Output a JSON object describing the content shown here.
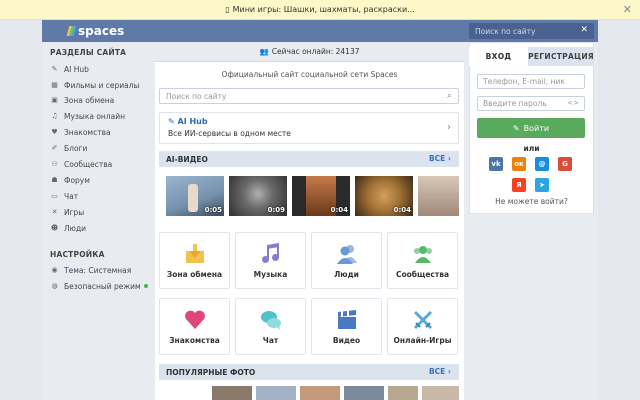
{
  "banner": {
    "text": "Мини игры: Шашки, шахматы, раскраски..."
  },
  "header": {
    "logo": "spaces",
    "search_placeholder": "Поиск по сайту"
  },
  "sidebar": {
    "sections_title": "РАЗДЕЛЫ САЙТА",
    "items": [
      {
        "label": "AI Hub",
        "icon": "wand-icon"
      },
      {
        "label": "Фильмы и сериалы",
        "icon": "film-icon"
      },
      {
        "label": "Зона обмена",
        "icon": "download-icon"
      },
      {
        "label": "Музыка онлайн",
        "icon": "music-icon"
      },
      {
        "label": "Знакомства",
        "icon": "heart-icon"
      },
      {
        "label": "Блоги",
        "icon": "pencil-icon"
      },
      {
        "label": "Сообщества",
        "icon": "community-icon"
      },
      {
        "label": "Форум",
        "icon": "forum-icon"
      },
      {
        "label": "Чат",
        "icon": "chat-icon"
      },
      {
        "label": "Игры",
        "icon": "games-icon"
      },
      {
        "label": "Люди",
        "icon": "people-icon"
      }
    ],
    "settings_title": "НАСТРОЙКА",
    "settings": [
      {
        "label": "Тема: Системная",
        "icon": "palette-icon"
      },
      {
        "label": "Безопасный режим",
        "icon": "safe-mode-icon"
      }
    ]
  },
  "main": {
    "online": "Сейчас онлайн: 24137",
    "official": "Официальный сайт социальной сети Spaces",
    "search_placeholder": "Поиск по сайту",
    "aihub_title": "AI Hub",
    "aihub_sub": "Все ИИ-сервисы в одном месте",
    "ai_video_title": "AI-ВИДЕО",
    "all_label": "ВСЕ",
    "videos": [
      {
        "duration": "0:05",
        "color": "#8aa7c4"
      },
      {
        "duration": "0:09",
        "color": "#6b6b6b"
      },
      {
        "duration": "0:04",
        "color": "#7a4a2a"
      },
      {
        "duration": "0:04",
        "color": "#a87a3a"
      },
      {
        "duration": "",
        "color": "#c8b8a8"
      }
    ],
    "tiles": [
      {
        "label": "Зона обмена",
        "icon": "download-box-icon",
        "color": "#f2c14e"
      },
      {
        "label": "Музыка",
        "icon": "music-note-icon",
        "color": "#8a7bd0"
      },
      {
        "label": "Люди",
        "icon": "people-icon",
        "color": "#6a98d8"
      },
      {
        "label": "Сообщества",
        "icon": "community-icon",
        "color": "#56b96a"
      },
      {
        "label": "Знакомства",
        "icon": "heart-icon",
        "color": "#e0457b"
      },
      {
        "label": "Чат",
        "icon": "chat-bubbles-icon",
        "color": "#4fc1c9"
      },
      {
        "label": "Видео",
        "icon": "clapper-icon",
        "color": "#4a78c2"
      },
      {
        "label": "Онлайн-Игры",
        "icon": "swords-icon",
        "color": "#58a9d8"
      }
    ],
    "popular_title": "ПОПУЛЯРНЫЕ ФОТО"
  },
  "auth": {
    "tab_login": "ВХОД",
    "tab_register": "РЕГИСТРАЦИЯ",
    "login_placeholder": "Телефон, E-mail, ник",
    "password_placeholder": "Введите пароль",
    "login_button": "Войти",
    "or": "или",
    "forgot": "Не можете войти?",
    "social": [
      {
        "name": "vk-icon",
        "glyph": "vk",
        "color": "#4a76a8"
      },
      {
        "name": "odnoklassniki-icon",
        "glyph": "ок",
        "color": "#ee8208"
      },
      {
        "name": "mail-ru-icon",
        "glyph": "@",
        "color": "#168de2"
      },
      {
        "name": "google-icon",
        "glyph": "G",
        "color": "#dd4b39"
      },
      {
        "name": "yandex-icon",
        "glyph": "Я",
        "color": "#fc3f1d"
      },
      {
        "name": "telegram-icon",
        "glyph": "➤",
        "color": "#2ca5e0"
      }
    ]
  }
}
